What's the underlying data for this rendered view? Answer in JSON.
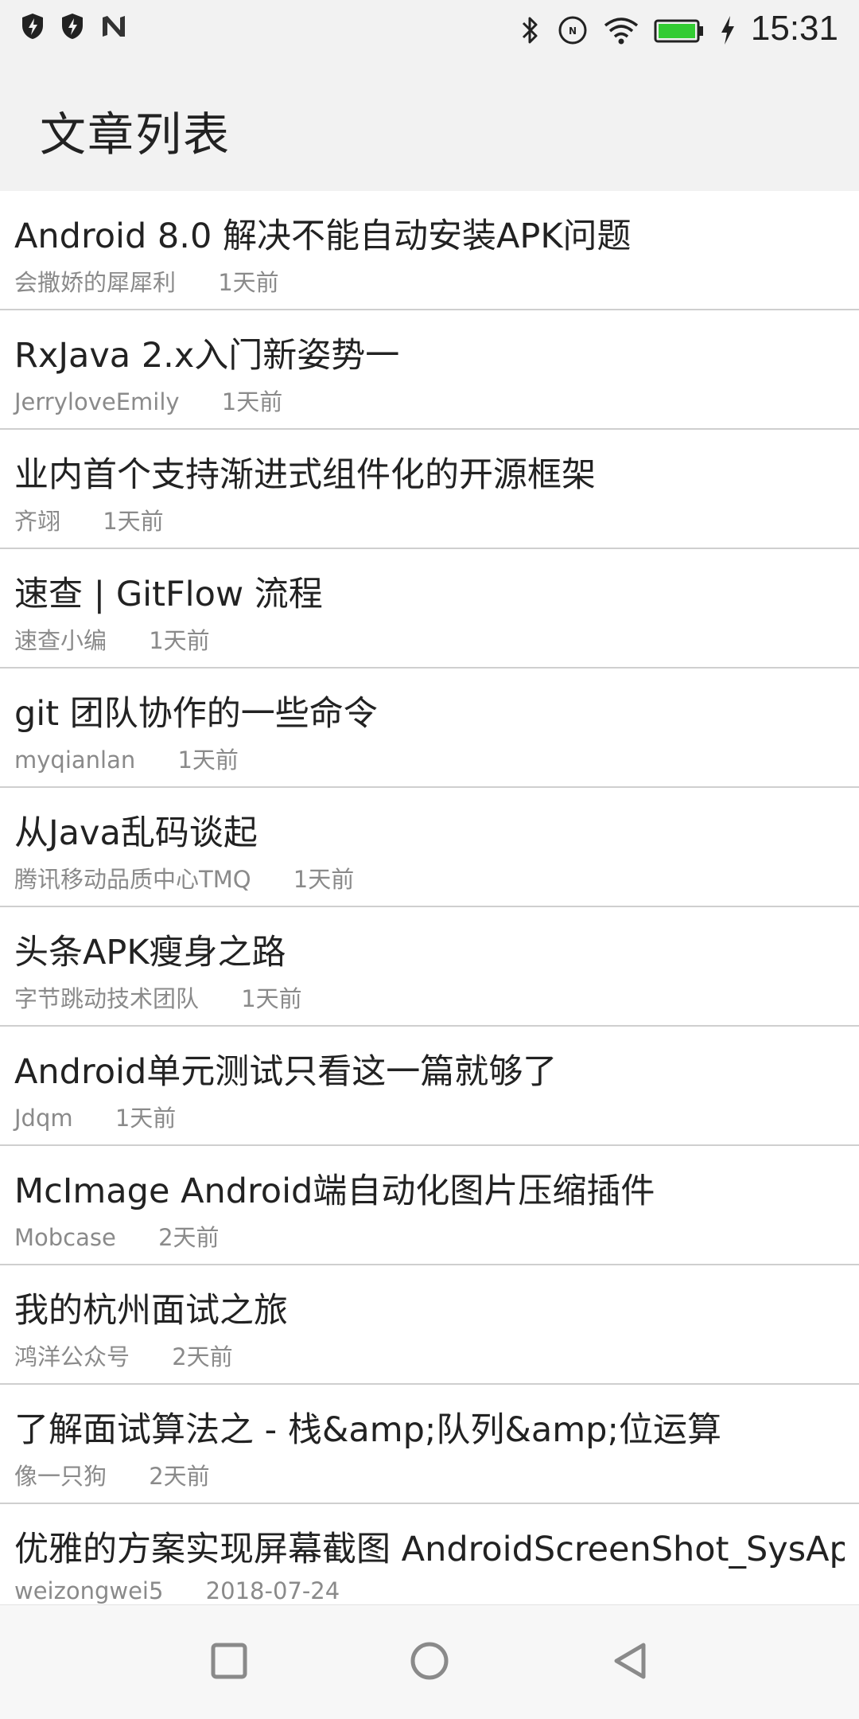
{
  "status_bar": {
    "time": "15:31",
    "left_icons": [
      "shield-bolt-icon",
      "shield-bolt-icon",
      "n-logo-icon"
    ],
    "right_icons": [
      "bluetooth-icon",
      "nfc-icon",
      "wifi-icon",
      "battery-icon",
      "charging-bolt-icon"
    ],
    "battery_level": 1.0,
    "battery_color": "#33cc33"
  },
  "toolbar": {
    "title": "文章列表"
  },
  "articles": [
    {
      "title": "Android 8.0 解决不能自动安装APK问题",
      "author": "会撒娇的犀犀利",
      "time": "1天前"
    },
    {
      "title": "RxJava 2.x入门新姿势一",
      "author": " JerryloveEmily",
      "time": "1天前"
    },
    {
      "title": "业内首个支持渐进式组件化的开源框架",
      "author": "齐翊",
      "time": "1天前"
    },
    {
      "title": "速查 | GitFlow 流程",
      "author": "速查小编",
      "time": "1天前"
    },
    {
      "title": "git 团队协作的一些命令",
      "author": "myqianlan",
      "time": "1天前"
    },
    {
      "title": "从Java乱码谈起",
      "author": "腾讯移动品质中心TMQ",
      "time": "1天前"
    },
    {
      "title": "头条APK瘦身之路",
      "author": "字节跳动技术团队",
      "time": "1天前"
    },
    {
      "title": "Android单元测试只看这一篇就够了",
      "author": "Jdqm",
      "time": "1天前"
    },
    {
      "title": "McImage Android端自动化图片压缩插件",
      "author": "Mobcase",
      "time": "2天前"
    },
    {
      "title": "我的杭州面试之旅",
      "author": "鸿洋公众号",
      "time": "2天前"
    },
    {
      "title": "了解面试算法之 - 栈&amp;队列&amp;位运算",
      "author": "像一只狗",
      "time": "2天前"
    },
    {
      "title": "优雅的方案实现屏幕截图  AndroidScreenShot_SysApi",
      "author": "weizongwei5",
      "time": "2018-07-24"
    }
  ],
  "nav_bar": {
    "icons": [
      "recents-square-icon",
      "home-circle-icon",
      "back-triangle-icon"
    ]
  }
}
